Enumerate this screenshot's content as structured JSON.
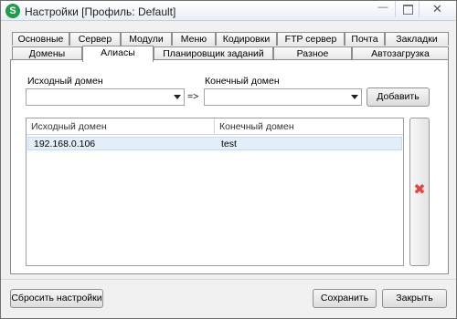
{
  "window": {
    "title": "Настройки [Профиль: Default]",
    "app_icon_letter": "S",
    "controls": {
      "minimize": "—",
      "maximize": "",
      "close": "✕"
    }
  },
  "tabs_row1": [
    "Основные",
    "Сервер",
    "Модули",
    "Меню",
    "Кодировки",
    "FTP сервер",
    "Почта",
    "Закладки"
  ],
  "tabs_row2": [
    "Домены",
    "Алиасы",
    "Планировщик заданий",
    "Разное",
    "Автозагрузка"
  ],
  "active_tab": "Алиасы",
  "form": {
    "source_label": "Исходный домен",
    "target_label": "Конечный домен",
    "source_value": "",
    "target_value": "",
    "arrow": "=>",
    "add_button": "Добавить"
  },
  "table": {
    "columns": [
      "Исходный домен",
      "Конечный домен"
    ],
    "rows": [
      [
        "192.168.0.106",
        "test"
      ]
    ]
  },
  "footer": {
    "reset_button": "Сбросить настройки",
    "save_button": "Сохранить",
    "close_button": "Закрыть"
  },
  "colors": {
    "delete_icon": "#e2473a",
    "selected_row": "#e3eef9",
    "app_icon": "#1f9d4a"
  },
  "icons": {
    "delete": "delete-x-icon"
  }
}
